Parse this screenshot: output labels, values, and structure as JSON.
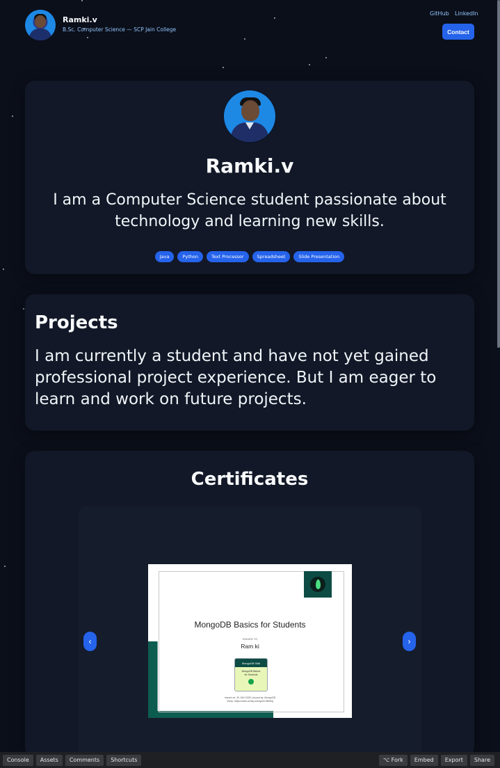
{
  "header": {
    "name": "Ramki.v",
    "subtitle": "B.Sc. Computer Science — SCP Jain College",
    "nav": [
      "GitHub",
      "LinkedIn"
    ],
    "contact_label": "Contact"
  },
  "hero": {
    "name": "Ramki.v",
    "bio": "I am a Computer Science student passionate about technology and learning new skills.",
    "skills": [
      "Java",
      "Python",
      "Text Processor",
      "Spreadsheet",
      "Slide Presentation"
    ]
  },
  "projects": {
    "title": "Projects",
    "text": "I am currently a student and have not yet gained professional project experience. But I am eager to learn and work on future projects."
  },
  "certificates": {
    "title": "Certificates",
    "prev": "‹",
    "next": "›",
    "cert": {
      "heading": "MongoDB Basics for Students",
      "issued_to": "ISSUED TO",
      "person": "Ram ki",
      "badge_top": "MongoDB Skill",
      "badge_line1": "MongoDB Basics",
      "badge_line2": "for Students",
      "meta_line1": "Issued on: 20 JUN 2025 | Issued by: MongoDB",
      "meta_line2": "Verify: https://www.credly.com/go/hC8MHdj"
    }
  },
  "toolbar": {
    "left": [
      "Console",
      "Assets",
      "Comments",
      "Shortcuts"
    ],
    "right": [
      "⌥ Fork",
      "Embed",
      "Export",
      "Share"
    ]
  },
  "colors": {
    "accent": "#2563eb",
    "background": "#0b0f1a",
    "card": "#121827"
  }
}
